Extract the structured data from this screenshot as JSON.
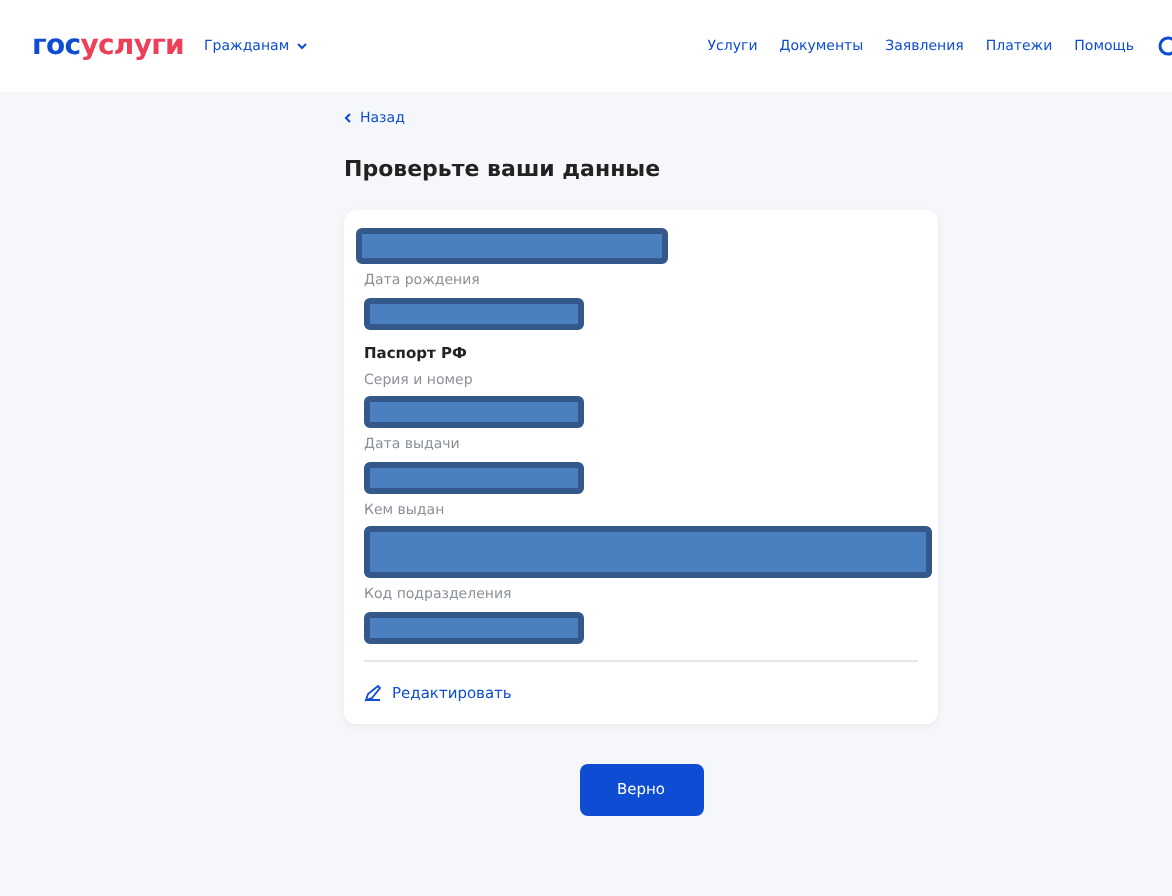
{
  "header": {
    "logo": [
      {
        "text": "гос",
        "kind": "primary"
      },
      {
        "text": "услуги",
        "kind": "accent"
      }
    ],
    "audience": "Гражданам",
    "nav": [
      "Услуги",
      "Документы",
      "Заявления",
      "Платежи",
      "Помощь"
    ]
  },
  "back_link": "Назад",
  "title": "Проверьте ваши данные",
  "card": {
    "items": [
      {
        "kind": "redacted_name"
      },
      {
        "kind": "field",
        "label": "Дата рождения"
      },
      {
        "kind": "heading",
        "text": "Паспорт РФ"
      },
      {
        "kind": "field",
        "label": "Серия и номер"
      },
      {
        "kind": "field",
        "label": "Дата выдачи"
      },
      {
        "kind": "wide_field",
        "label": "Кем выдан"
      },
      {
        "kind": "field",
        "label": "Код подразделения"
      }
    ],
    "edit_link": "Редактировать"
  },
  "confirm_button": "Верно"
}
